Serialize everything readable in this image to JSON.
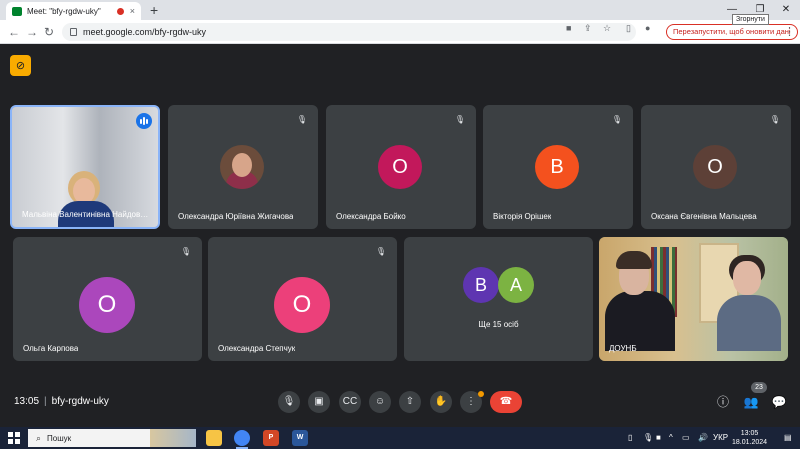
{
  "browser": {
    "tab_title": "Meet: \"bfy-rgdw-uky\"",
    "tab_close": "×",
    "new_tab": "+",
    "window_controls": {
      "minimize": "—",
      "maximize": "❐",
      "close": "✕"
    },
    "tooltip": "Згорнути",
    "url": "meet.google.com/bfy-rgdw-uky",
    "restart_button": "Перезапустити, щоб оновити дані",
    "menu_dots": "⋮"
  },
  "meet": {
    "badge_icon": "no-camera-icon",
    "tiles": [
      {
        "name": "Мальвіна Валентинівна Найдов…",
        "kind": "video",
        "speaking": true
      },
      {
        "name": "Олександра Юріївна Жигачова",
        "kind": "photo",
        "muted": true
      },
      {
        "name": "Олександра Бойко",
        "kind": "letter",
        "letter": "О",
        "color": "#c2185b",
        "muted": true
      },
      {
        "name": "Вікторія Орішек",
        "kind": "letter",
        "letter": "В",
        "color": "#f4511e",
        "muted": true
      },
      {
        "name": "Оксана Євгенівна Мальцева",
        "kind": "letter",
        "letter": "О",
        "color": "#5d4037",
        "muted": true
      },
      {
        "name": "Ольга Карпова",
        "kind": "letter",
        "letter": "О",
        "color": "#ab47bc",
        "muted": true
      },
      {
        "name": "Олександра Степчук",
        "kind": "letter",
        "letter": "О",
        "color": "#ec407a",
        "muted": true
      }
    ],
    "others": {
      "letters": [
        "В",
        "А"
      ],
      "colors": [
        "#5e35b1",
        "#7cb342"
      ],
      "label": "Ще 15 осіб"
    },
    "room_tile_name": "ДОУНБ",
    "mute_glyph": "🎙",
    "time": "13:05",
    "meeting_code": "bfy-rgdw-uky",
    "participant_count": "23",
    "accent": "#8ab4f8",
    "hangup_color": "#ea4335"
  },
  "taskbar": {
    "search_text": "Пошук",
    "lang": "УКР",
    "time": "13:05",
    "date": "18.01.2024"
  }
}
